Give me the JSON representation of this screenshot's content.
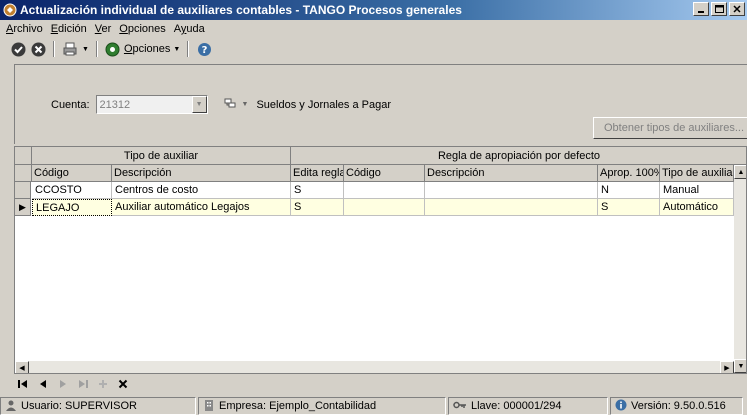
{
  "window": {
    "title": "Actualización individual de auxiliares contables - TANGO Procesos generales"
  },
  "menu": [
    {
      "accel": "A",
      "rest": "rchivo"
    },
    {
      "accel": "E",
      "rest": "dición"
    },
    {
      "accel": "V",
      "rest": "er"
    },
    {
      "accel": "O",
      "rest": "pciones"
    },
    {
      "pre": "A",
      "accel": "y",
      "rest": "uda"
    }
  ],
  "toolbar": {
    "opciones_accel": "O",
    "opciones_rest": "pciones"
  },
  "form": {
    "cuenta_label": "Cuenta:",
    "cuenta_value": "21312",
    "cuenta_desc": "Sueldos y Jornales a Pagar",
    "obtener_label": "Obtener tipos de auxiliares..."
  },
  "grid": {
    "group_headers": [
      "Tipo de auxiliar",
      "Regla de apropiación por defecto"
    ],
    "columns": [
      "Código",
      "Descripción",
      "Edita regla",
      "Código",
      "Descripción",
      "Aprop. 100%",
      "Tipo de auxiliar"
    ],
    "rows": [
      {
        "codigo": "CCOSTO",
        "descripcion": "Centros de costo",
        "edita": "S",
        "regla_codigo": "",
        "regla_desc": "",
        "aprop": "N",
        "tipo": "Manual",
        "selected": false
      },
      {
        "codigo": "LEGAJO",
        "descripcion": "Auxiliar automático Legajos",
        "edita": "S",
        "regla_codigo": "",
        "regla_desc": "",
        "aprop": "S",
        "tipo": "Automático",
        "selected": true
      }
    ]
  },
  "status": {
    "usuario": "Usuario: SUPERVISOR",
    "empresa": "Empresa: Ejemplo_Contabilidad",
    "llave": "Llave: 000001/294",
    "version": "Versión: 9.50.0.516"
  },
  "colors": {
    "title_bar": "#0a246a",
    "selected_row": "#ffffe1",
    "face": "#d4d0c8"
  }
}
